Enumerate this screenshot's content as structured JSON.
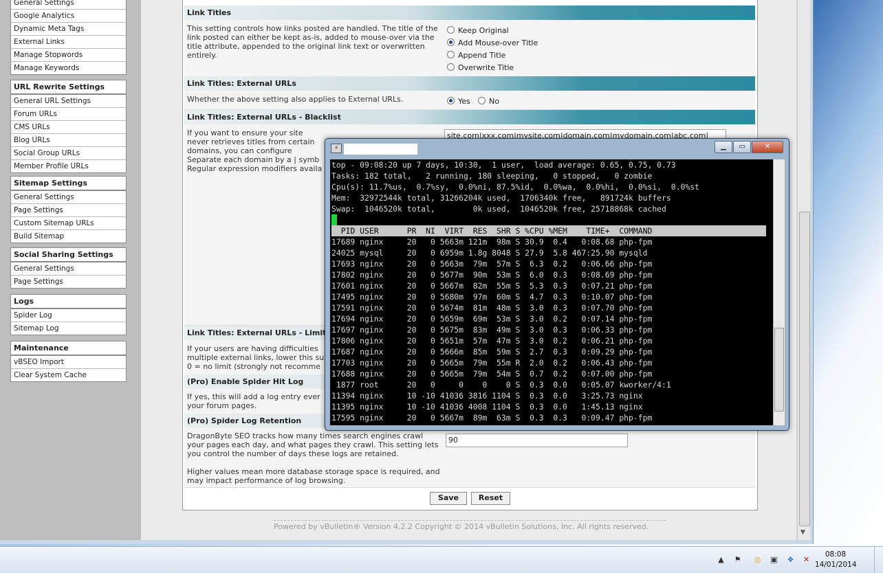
{
  "sidebar": {
    "groups": [
      {
        "title": "",
        "items": [
          "General Settings",
          "Google Analytics",
          "Dynamic Meta Tags",
          "External Links",
          "Manage Stopwords",
          "Manage Keywords"
        ]
      },
      {
        "title": "URL Rewrite Settings",
        "items": [
          "General URL Settings",
          "Forum URLs",
          "CMS URLs",
          "Blog URLs",
          "Social Group URLs",
          "Member Profile URLs"
        ]
      },
      {
        "title": "Sitemap Settings",
        "items": [
          "General Settings",
          "Page Settings",
          "Custom Sitemap URLs",
          "Build Sitemap"
        ]
      },
      {
        "title": "Social Sharing Settings",
        "items": [
          "General Settings",
          "Page Settings"
        ]
      },
      {
        "title": "Logs",
        "items": [
          "Spider Log",
          "Sitemap Log"
        ]
      },
      {
        "title": "Maintenance",
        "items": [
          "vBSEO Import",
          "Clear System Cache"
        ]
      }
    ]
  },
  "main": {
    "link_titles": {
      "header": "Link Titles",
      "desc": "This setting controls how links posted are handled. The title of the link posted can either be kept as-is, added to mouse-over via the title attribute, appended to the original link text or overwritten entirely.",
      "options": [
        "Keep Original",
        "Add Mouse-over Title",
        "Append Title",
        "Overwrite Title"
      ],
      "selected": 1
    },
    "external_urls": {
      "header": "Link Titles: External URLs",
      "desc": "Whether the above setting also applies to External URLs.",
      "yes": "Yes",
      "no": "No"
    },
    "blacklist": {
      "header": "Link Titles: External URLs - Blacklist",
      "desc1": "If you want to ensure your site never retrieves titles from certain domains, you can configure",
      "desc2": "Separate each domain by a | symb Regular expression modifiers availa",
      "value": "site.com|xxx.com|mysite.com|domain.com|mydomain.com|abc.com|"
    },
    "limit": {
      "header": "Link Titles: External URLs - Limit",
      "desc": "If your users are having difficulties multiple external links, lower this su 0 = no limit (strongly not recomme"
    },
    "spider_hit": {
      "header": "(Pro) Enable Spider Hit Log",
      "desc": "If yes, this will add a log entry ever your forum pages."
    },
    "spider_retention": {
      "header": "(Pro) Spider Log Retention",
      "desc1": "DragonByte SEO tracks how many times search engines crawl your pages each day, and what pages they crawl. This setting lets you control the number of days these logs are retained.",
      "desc2": "Higher values mean more database storage space is required, and may impact performance of log browsing.",
      "value": "90"
    },
    "save_label": "Save",
    "reset_label": "Reset",
    "footer": "Powered by vBulletin® Version 4.2.2 Copyright © 2014 vBulletin Solutions, Inc. All rights reserved."
  },
  "terminal": {
    "summary": [
      "top - 09:08:20 up 7 days, 10:30,  1 user,  load average: 0.65, 0.75, 0.73",
      "Tasks: 182 total,   2 running, 180 sleeping,   0 stopped,   0 zombie",
      "Cpu(s): 11.7%us,  0.7%sy,  0.0%ni, 87.5%id,  0.0%wa,  0.0%hi,  0.0%si,  0.0%st",
      "Mem:  32972544k total, 31266204k used,  1706340k free,   891724k buffers",
      "Swap:  1046520k total,        0k used,  1046520k free, 25718868k cached"
    ],
    "proc_header": "  PID USER      PR  NI  VIRT  RES  SHR S %CPU %MEM    TIME+  COMMAND",
    "procs": [
      "17689 nginx     20   0 5663m 121m  98m S 30.9  0.4   0:08.68 php-fpm",
      "24025 mysql     20   0 6959m 1.8g 8048 S 27.9  5.8 467:25.90 mysqld",
      "17693 nginx     20   0 5663m  79m  57m S  6.3  0.2   0:06.66 php-fpm",
      "17802 nginx     20   0 5677m  90m  53m S  6.0  0.3   0:08.69 php-fpm",
      "17601 nginx     20   0 5667m  82m  55m S  5.3  0.3   0:07.21 php-fpm",
      "17495 nginx     20   0 5680m  97m  60m S  4.7  0.3   0:10.07 php-fpm",
      "17591 nginx     20   0 5674m  81m  48m S  3.0  0.3   0:07.70 php-fpm",
      "17694 nginx     20   0 5659m  69m  53m S  3.0  0.2   0:07.14 php-fpm",
      "17697 nginx     20   0 5675m  83m  49m S  3.0  0.3   0:06.33 php-fpm",
      "17806 nginx     20   0 5651m  57m  47m S  3.0  0.2   0:06.21 php-fpm",
      "17687 nginx     20   0 5666m  85m  59m S  2.7  0.3   0:09.29 php-fpm",
      "17703 nginx     20   0 5665m  79m  55m R  2.0  0.2   0:06.43 php-fpm",
      "17688 nginx     20   0 5665m  79m  54m S  0.7  0.2   0:07.00 php-fpm",
      " 1877 root      20   0     0    0    0 S  0.3  0.0   0:05.07 kworker/4:1",
      "11394 nginx     10 -10 41036 3816 1104 S  0.3  0.0   3:25.73 nginx",
      "11395 nginx     10 -10 41036 4008 1104 S  0.3  0.0   1:45.13 nginx",
      "17595 nginx     20   0 5667m  89m  63m S  0.3  0.3   0:09.47 php-fpm"
    ]
  },
  "taskbar": {
    "time": "08:08",
    "date": "14/01/2014",
    "tray_icons": [
      "chevron-up-icon",
      "flag-icon",
      "network-update-icon",
      "display-icon",
      "dropbox-icon",
      "volume-mute-icon"
    ]
  }
}
